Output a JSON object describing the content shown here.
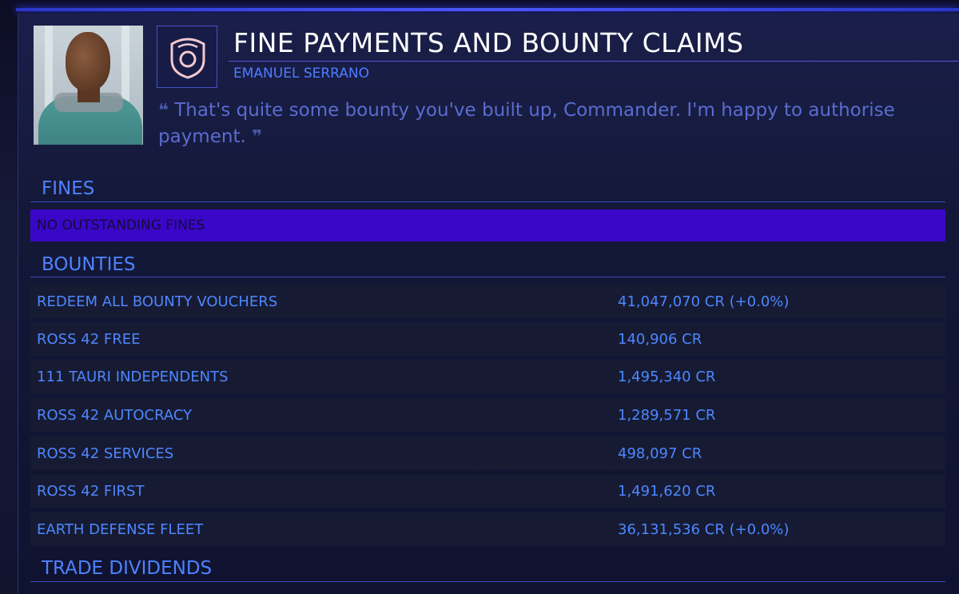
{
  "header": {
    "title": "FINE PAYMENTS AND BOUNTY CLAIMS",
    "contact_name": "EMANUEL SERRANO",
    "quote_open": "❝",
    "quote_text": "That's quite some bounty you've built up, Commander. I'm happy to authorise payment.",
    "quote_close": "❞",
    "emblem_icon": "shield-icon"
  },
  "colors": {
    "accent": "#4e86ff",
    "selected_row": "#3a07c8",
    "title": "#ffffff"
  },
  "fines": {
    "header": "FINES",
    "rows": [
      {
        "label": "NO OUTSTANDING FINES"
      }
    ]
  },
  "bounties": {
    "header": "BOUNTIES",
    "rows": [
      {
        "name": "REDEEM ALL BOUNTY VOUCHERS",
        "amount": "41,047,070 CR (+0.0%)"
      },
      {
        "name": "ROSS 42 FREE",
        "amount": "140,906 CR"
      },
      {
        "name": "111 TAURI INDEPENDENTS",
        "amount": "1,495,340 CR"
      },
      {
        "name": "ROSS 42 AUTOCRACY",
        "amount": "1,289,571 CR"
      },
      {
        "name": "ROSS 42 SERVICES",
        "amount": "498,097 CR"
      },
      {
        "name": "ROSS 42 FIRST",
        "amount": "1,491,620 CR"
      },
      {
        "name": "EARTH DEFENSE FLEET",
        "amount": "36,131,536 CR (+0.0%)"
      }
    ]
  },
  "trade_dividends": {
    "header": "TRADE DIVIDENDS"
  }
}
